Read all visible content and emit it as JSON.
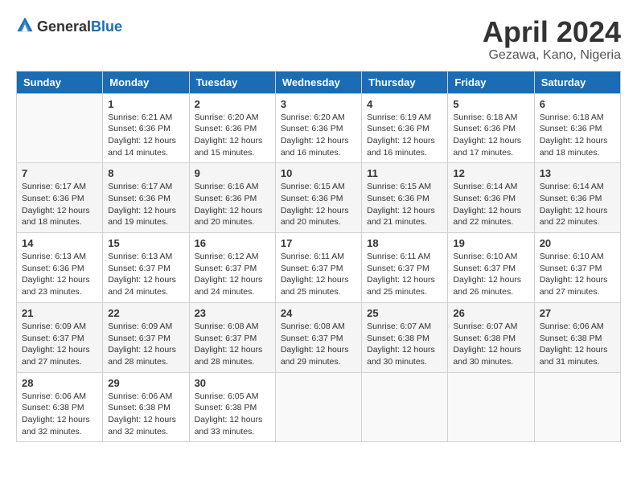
{
  "header": {
    "logo_general": "General",
    "logo_blue": "Blue",
    "month_title": "April 2024",
    "location": "Gezawa, Kano, Nigeria"
  },
  "days_of_week": [
    "Sunday",
    "Monday",
    "Tuesday",
    "Wednesday",
    "Thursday",
    "Friday",
    "Saturday"
  ],
  "weeks": [
    [
      {
        "day": "",
        "info": ""
      },
      {
        "day": "1",
        "info": "Sunrise: 6:21 AM\nSunset: 6:36 PM\nDaylight: 12 hours\nand 14 minutes."
      },
      {
        "day": "2",
        "info": "Sunrise: 6:20 AM\nSunset: 6:36 PM\nDaylight: 12 hours\nand 15 minutes."
      },
      {
        "day": "3",
        "info": "Sunrise: 6:20 AM\nSunset: 6:36 PM\nDaylight: 12 hours\nand 16 minutes."
      },
      {
        "day": "4",
        "info": "Sunrise: 6:19 AM\nSunset: 6:36 PM\nDaylight: 12 hours\nand 16 minutes."
      },
      {
        "day": "5",
        "info": "Sunrise: 6:18 AM\nSunset: 6:36 PM\nDaylight: 12 hours\nand 17 minutes."
      },
      {
        "day": "6",
        "info": "Sunrise: 6:18 AM\nSunset: 6:36 PM\nDaylight: 12 hours\nand 18 minutes."
      }
    ],
    [
      {
        "day": "7",
        "info": "Sunrise: 6:17 AM\nSunset: 6:36 PM\nDaylight: 12 hours\nand 18 minutes."
      },
      {
        "day": "8",
        "info": "Sunrise: 6:17 AM\nSunset: 6:36 PM\nDaylight: 12 hours\nand 19 minutes."
      },
      {
        "day": "9",
        "info": "Sunrise: 6:16 AM\nSunset: 6:36 PM\nDaylight: 12 hours\nand 20 minutes."
      },
      {
        "day": "10",
        "info": "Sunrise: 6:15 AM\nSunset: 6:36 PM\nDaylight: 12 hours\nand 20 minutes."
      },
      {
        "day": "11",
        "info": "Sunrise: 6:15 AM\nSunset: 6:36 PM\nDaylight: 12 hours\nand 21 minutes."
      },
      {
        "day": "12",
        "info": "Sunrise: 6:14 AM\nSunset: 6:36 PM\nDaylight: 12 hours\nand 22 minutes."
      },
      {
        "day": "13",
        "info": "Sunrise: 6:14 AM\nSunset: 6:36 PM\nDaylight: 12 hours\nand 22 minutes."
      }
    ],
    [
      {
        "day": "14",
        "info": "Sunrise: 6:13 AM\nSunset: 6:36 PM\nDaylight: 12 hours\nand 23 minutes."
      },
      {
        "day": "15",
        "info": "Sunrise: 6:13 AM\nSunset: 6:37 PM\nDaylight: 12 hours\nand 24 minutes."
      },
      {
        "day": "16",
        "info": "Sunrise: 6:12 AM\nSunset: 6:37 PM\nDaylight: 12 hours\nand 24 minutes."
      },
      {
        "day": "17",
        "info": "Sunrise: 6:11 AM\nSunset: 6:37 PM\nDaylight: 12 hours\nand 25 minutes."
      },
      {
        "day": "18",
        "info": "Sunrise: 6:11 AM\nSunset: 6:37 PM\nDaylight: 12 hours\nand 25 minutes."
      },
      {
        "day": "19",
        "info": "Sunrise: 6:10 AM\nSunset: 6:37 PM\nDaylight: 12 hours\nand 26 minutes."
      },
      {
        "day": "20",
        "info": "Sunrise: 6:10 AM\nSunset: 6:37 PM\nDaylight: 12 hours\nand 27 minutes."
      }
    ],
    [
      {
        "day": "21",
        "info": "Sunrise: 6:09 AM\nSunset: 6:37 PM\nDaylight: 12 hours\nand 27 minutes."
      },
      {
        "day": "22",
        "info": "Sunrise: 6:09 AM\nSunset: 6:37 PM\nDaylight: 12 hours\nand 28 minutes."
      },
      {
        "day": "23",
        "info": "Sunrise: 6:08 AM\nSunset: 6:37 PM\nDaylight: 12 hours\nand 28 minutes."
      },
      {
        "day": "24",
        "info": "Sunrise: 6:08 AM\nSunset: 6:37 PM\nDaylight: 12 hours\nand 29 minutes."
      },
      {
        "day": "25",
        "info": "Sunrise: 6:07 AM\nSunset: 6:38 PM\nDaylight: 12 hours\nand 30 minutes."
      },
      {
        "day": "26",
        "info": "Sunrise: 6:07 AM\nSunset: 6:38 PM\nDaylight: 12 hours\nand 30 minutes."
      },
      {
        "day": "27",
        "info": "Sunrise: 6:06 AM\nSunset: 6:38 PM\nDaylight: 12 hours\nand 31 minutes."
      }
    ],
    [
      {
        "day": "28",
        "info": "Sunrise: 6:06 AM\nSunset: 6:38 PM\nDaylight: 12 hours\nand 32 minutes."
      },
      {
        "day": "29",
        "info": "Sunrise: 6:06 AM\nSunset: 6:38 PM\nDaylight: 12 hours\nand 32 minutes."
      },
      {
        "day": "30",
        "info": "Sunrise: 6:05 AM\nSunset: 6:38 PM\nDaylight: 12 hours\nand 33 minutes."
      },
      {
        "day": "",
        "info": ""
      },
      {
        "day": "",
        "info": ""
      },
      {
        "day": "",
        "info": ""
      },
      {
        "day": "",
        "info": ""
      }
    ]
  ]
}
